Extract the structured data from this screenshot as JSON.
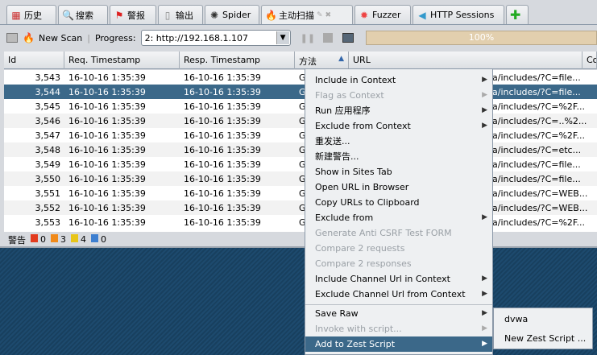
{
  "tabs": [
    {
      "label": "历史",
      "icon": "calendar-icon"
    },
    {
      "label": "搜索",
      "icon": "search-icon"
    },
    {
      "label": "警报",
      "icon": "flag-icon"
    },
    {
      "label": "输出",
      "icon": "document-icon"
    },
    {
      "label": "Spider",
      "icon": "spider-icon"
    },
    {
      "label": "主动扫描",
      "icon": "flame-icon",
      "active": true
    },
    {
      "label": "Fuzzer",
      "icon": "fuzzer-icon"
    },
    {
      "label": "HTTP Sessions",
      "icon": "sessions-icon"
    }
  ],
  "toolbar": {
    "new_scan": "New Scan",
    "progress_label": "Progress:",
    "progress_value": "2: http://192.168.1.107",
    "percent": "100%"
  },
  "columns": [
    "Id",
    "Req. Timestamp",
    "Resp. Timestamp",
    "方法",
    "URL",
    "Co"
  ],
  "rows": [
    {
      "id": "3,543",
      "req": "16-10-16 1:35:39",
      "resp": "16-10-16 1:35:39",
      "method": "G",
      "url": "a/includes/?C=file..."
    },
    {
      "id": "3,544",
      "req": "16-10-16 1:35:39",
      "resp": "16-10-16 1:35:39",
      "method": "G",
      "url": "a/includes/?C=file...",
      "selected": true
    },
    {
      "id": "3,545",
      "req": "16-10-16 1:35:39",
      "resp": "16-10-16 1:35:39",
      "method": "G",
      "url": "a/includes/?C=%2F..."
    },
    {
      "id": "3,546",
      "req": "16-10-16 1:35:39",
      "resp": "16-10-16 1:35:39",
      "method": "G",
      "url": "a/includes/?C=..%2..."
    },
    {
      "id": "3,547",
      "req": "16-10-16 1:35:39",
      "resp": "16-10-16 1:35:39",
      "method": "G",
      "url": "a/includes/?C=%2F..."
    },
    {
      "id": "3,548",
      "req": "16-10-16 1:35:39",
      "resp": "16-10-16 1:35:39",
      "method": "G",
      "url": "a/includes/?C=etc..."
    },
    {
      "id": "3,549",
      "req": "16-10-16 1:35:39",
      "resp": "16-10-16 1:35:39",
      "method": "G",
      "url": "a/includes/?C=file..."
    },
    {
      "id": "3,550",
      "req": "16-10-16 1:35:39",
      "resp": "16-10-16 1:35:39",
      "method": "G",
      "url": "a/includes/?C=file..."
    },
    {
      "id": "3,551",
      "req": "16-10-16 1:35:39",
      "resp": "16-10-16 1:35:39",
      "method": "G",
      "url": "a/includes/?C=WEB..."
    },
    {
      "id": "3,552",
      "req": "16-10-16 1:35:39",
      "resp": "16-10-16 1:35:39",
      "method": "G",
      "url": "a/includes/?C=WEB..."
    },
    {
      "id": "3,553",
      "req": "16-10-16 1:35:39",
      "resp": "16-10-16 1:35:39",
      "method": "G",
      "url": "a/includes/?C=%2F..."
    }
  ],
  "status": {
    "label": "警告",
    "counts": [
      {
        "value": "0",
        "color": "#e23b1e"
      },
      {
        "value": "3",
        "color": "#f08a1a"
      },
      {
        "value": "4",
        "color": "#e8c51a"
      },
      {
        "value": "0",
        "color": "#3d7fd0"
      }
    ]
  },
  "menu": [
    {
      "label": "Include in Context",
      "sub": true
    },
    {
      "label": "Flag as Context",
      "sub": true,
      "disabled": true
    },
    {
      "label": "Run 应用程序",
      "sub": true
    },
    {
      "label": "Exclude from Context",
      "sub": true
    },
    {
      "label": "重发送..."
    },
    {
      "label": "新建警告..."
    },
    {
      "label": "Show in Sites Tab"
    },
    {
      "label": "Open URL in Browser"
    },
    {
      "label": "Copy URLs to Clipboard"
    },
    {
      "label": "Exclude from",
      "sub": true
    },
    {
      "label": "Generate Anti CSRF Test FORM",
      "disabled": true
    },
    {
      "label": "Compare 2 requests",
      "disabled": true
    },
    {
      "label": "Compare 2 responses",
      "disabled": true
    },
    {
      "label": "Include Channel Url in Context",
      "sub": true
    },
    {
      "label": "Exclude Channel Url from Context",
      "sub": true
    },
    {
      "separator": true
    },
    {
      "label": "Save Raw",
      "sub": true
    },
    {
      "label": "Invoke with script...",
      "sub": true,
      "disabled": true
    },
    {
      "label": "Add to Zest Script",
      "sub": true,
      "highlighted": true
    }
  ],
  "submenu": [
    "dvwa",
    "New Zest Script ..."
  ]
}
